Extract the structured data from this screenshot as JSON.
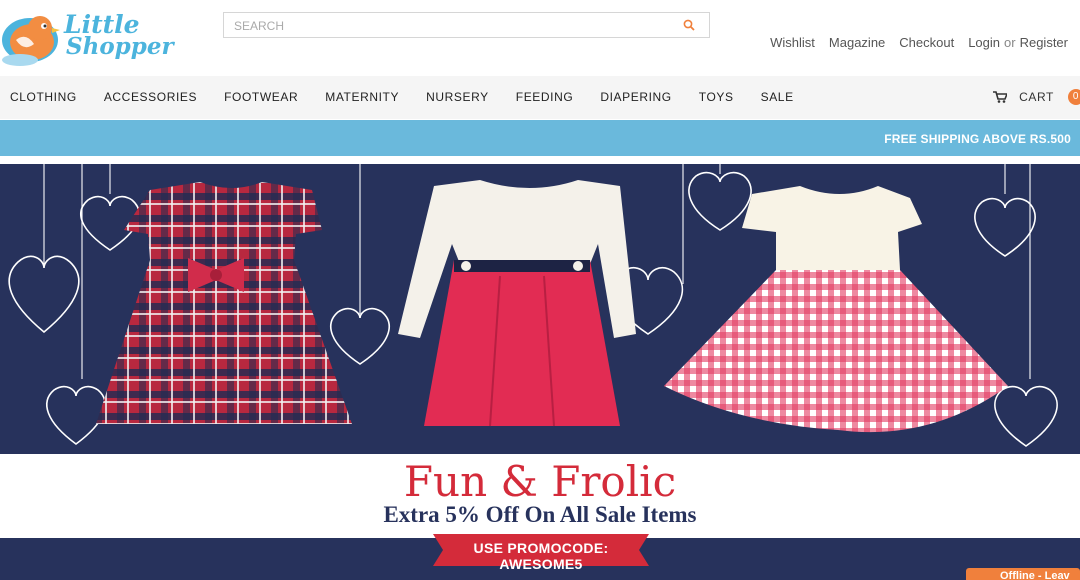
{
  "brand": {
    "line1": "Little",
    "line2": "Shopper"
  },
  "search": {
    "placeholder": "SEARCH"
  },
  "top_links": {
    "wishlist": "Wishlist",
    "magazine": "Magazine",
    "checkout": "Checkout",
    "login": "Login",
    "or": "or",
    "register": "Register"
  },
  "nav": {
    "items": [
      "CLOTHING",
      "ACCESSORIES",
      "FOOTWEAR",
      "MATERNITY",
      "NURSERY",
      "FEEDING",
      "DIAPERING",
      "TOYS",
      "SALE"
    ],
    "cart_label": "CART",
    "cart_count": "0"
  },
  "shipping_banner": "FREE SHIPPING ABOVE RS.500",
  "promo": {
    "headline": "Fun & Frolic",
    "subline": "Extra 5% Off On All Sale Items",
    "code": "USE PROMOCODE: AWESOME5"
  },
  "chat": {
    "label": "Offline - Leav"
  },
  "colors": {
    "accent_blue": "#6ab9dc",
    "navy": "#27325c",
    "promo_red": "#d42b3a",
    "orange": "#f0803c"
  }
}
